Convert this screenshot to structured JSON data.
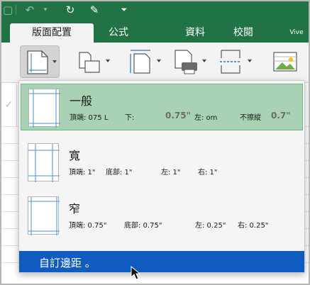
{
  "tabs": {
    "active": "版面配置",
    "formulas": "公式",
    "data": "資料",
    "review": "校閱",
    "view": "Vive"
  },
  "formula_bar_glyph": "✓",
  "margins_menu": {
    "options": [
      {
        "title": "一般",
        "top": "頂端: 075 L",
        "bottom": "下:",
        "bottom_value": "0.75\"",
        "left": "左: om",
        "right": "不擦縱",
        "right_value": "0.7\""
      },
      {
        "title": "寬",
        "top": "頂端: 1\"",
        "bottom": "底部: 1\"",
        "left": "左: 1\"",
        "right": "右: 1\""
      },
      {
        "title": "窄",
        "top": "頂端: 0.75\"",
        "bottom": "底部: 0.75\"",
        "left": "左: 0.25\"",
        "right": "右: 0.25\""
      }
    ],
    "custom": "自訂邊距 。"
  },
  "colors": {
    "ribbon_green": "#217346",
    "selected_option": "#a9d2b5",
    "custom_highlight": "#0f5bbf"
  },
  "icons": {
    "toolbar": [
      "margins-icon",
      "orientation-icon",
      "size-icon",
      "print-area-icon",
      "breaks-icon",
      "background-icon"
    ],
    "quick_access": [
      "save-icon",
      "undo-icon",
      "redo-icon",
      "edit-icon",
      "customize-icon"
    ]
  }
}
